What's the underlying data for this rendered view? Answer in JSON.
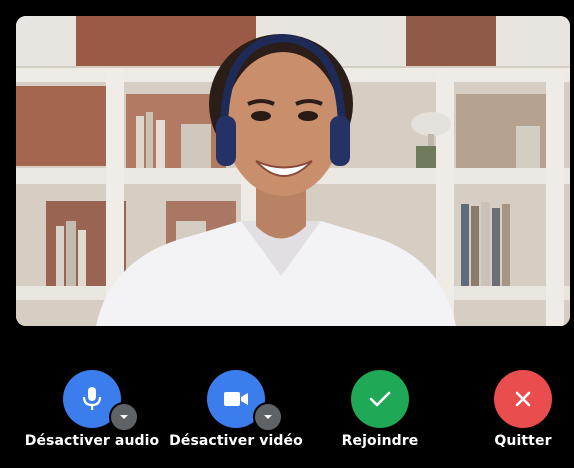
{
  "controls": {
    "mute_audio": {
      "label": "Désactiver audio",
      "color": "#3b7ded",
      "icon": "microphone-icon"
    },
    "mute_video": {
      "label": "Désactiver vidéo",
      "color": "#3b7ded",
      "icon": "video-camera-icon"
    },
    "join": {
      "label": "Rejoindre",
      "color": "#1fa855",
      "icon": "check-icon"
    },
    "quit": {
      "label": "Quitter",
      "color": "#ea4d4d",
      "icon": "close-icon"
    },
    "options_color": "#5f6368"
  }
}
